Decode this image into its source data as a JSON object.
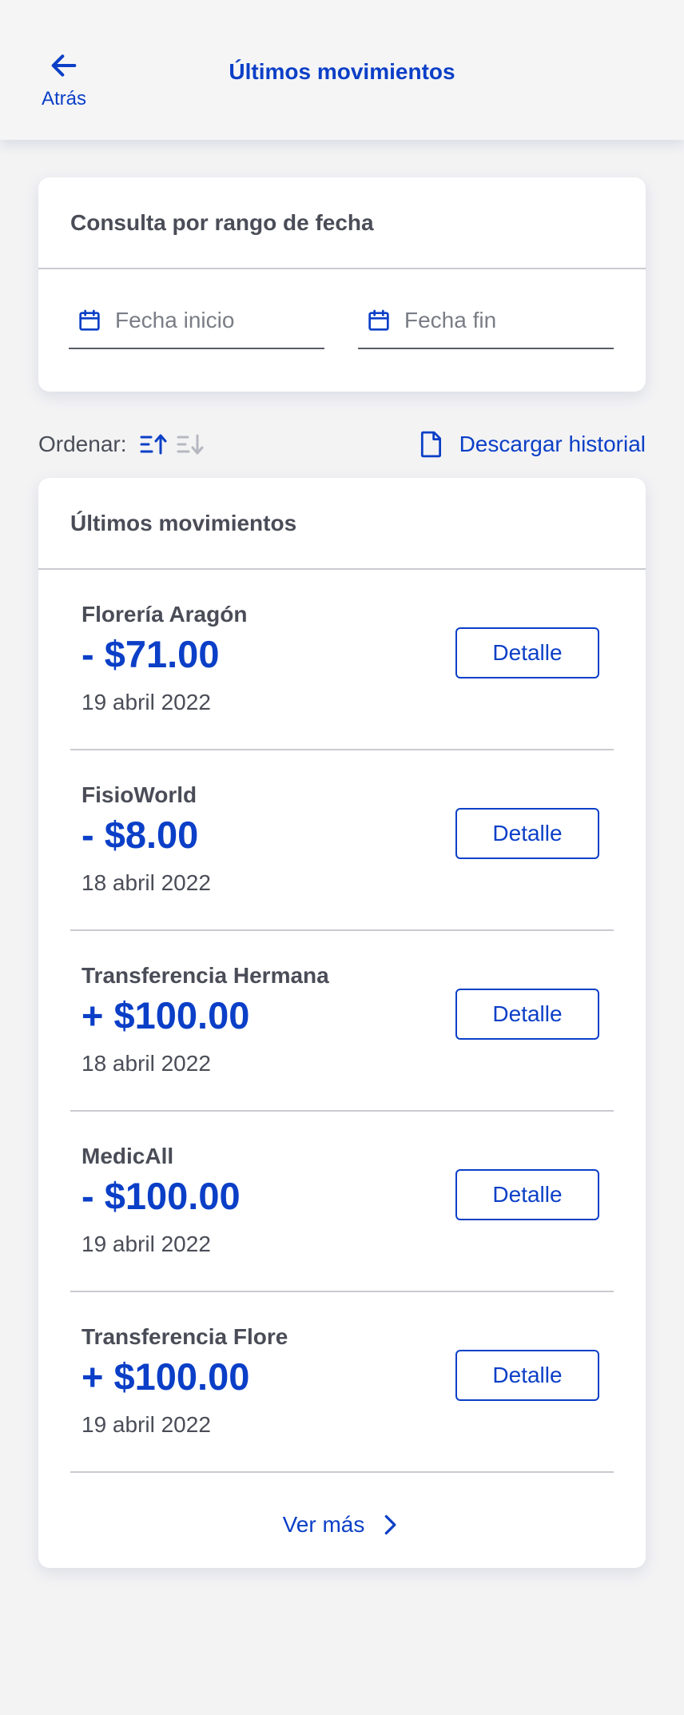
{
  "header": {
    "title": "Últimos movimientos",
    "back_label": "Atrás"
  },
  "date_filter": {
    "title": "Consulta por rango de fecha",
    "start_placeholder": "Fecha inicio",
    "end_placeholder": "Fecha fin"
  },
  "toolbar": {
    "order_label": "Ordenar:",
    "sort_options": [
      {
        "icon": "sort-ascending-icon",
        "active": true
      },
      {
        "icon": "sort-descending-icon",
        "active": false
      }
    ],
    "download_label": "Descargar historial"
  },
  "movements": {
    "title": "Últimos movimientos",
    "items": [
      {
        "name": "Florería Aragón",
        "amount": "- $71.00",
        "date": "19 abril 2022",
        "button": "Detalle"
      },
      {
        "name": "FisioWorld",
        "amount": "- $8.00",
        "date": "18 abril 2022",
        "button": "Detalle"
      },
      {
        "name": "Transferencia Hermana",
        "amount": "+ $100.00",
        "date": "18 abril 2022",
        "button": "Detalle"
      },
      {
        "name": "MedicAll",
        "amount": "- $100.00",
        "date": "19 abril 2022",
        "button": "Detalle"
      },
      {
        "name": "Transferencia Flore",
        "amount": "+ $100.00",
        "date": "19 abril 2022",
        "button": "Detalle"
      }
    ],
    "see_more_label": "Ver más"
  },
  "colors": {
    "accent": "#0b3fc7",
    "text": "#4a4d57",
    "background": "#f3f3f4",
    "inactive_icon": "#b5b8c0"
  }
}
